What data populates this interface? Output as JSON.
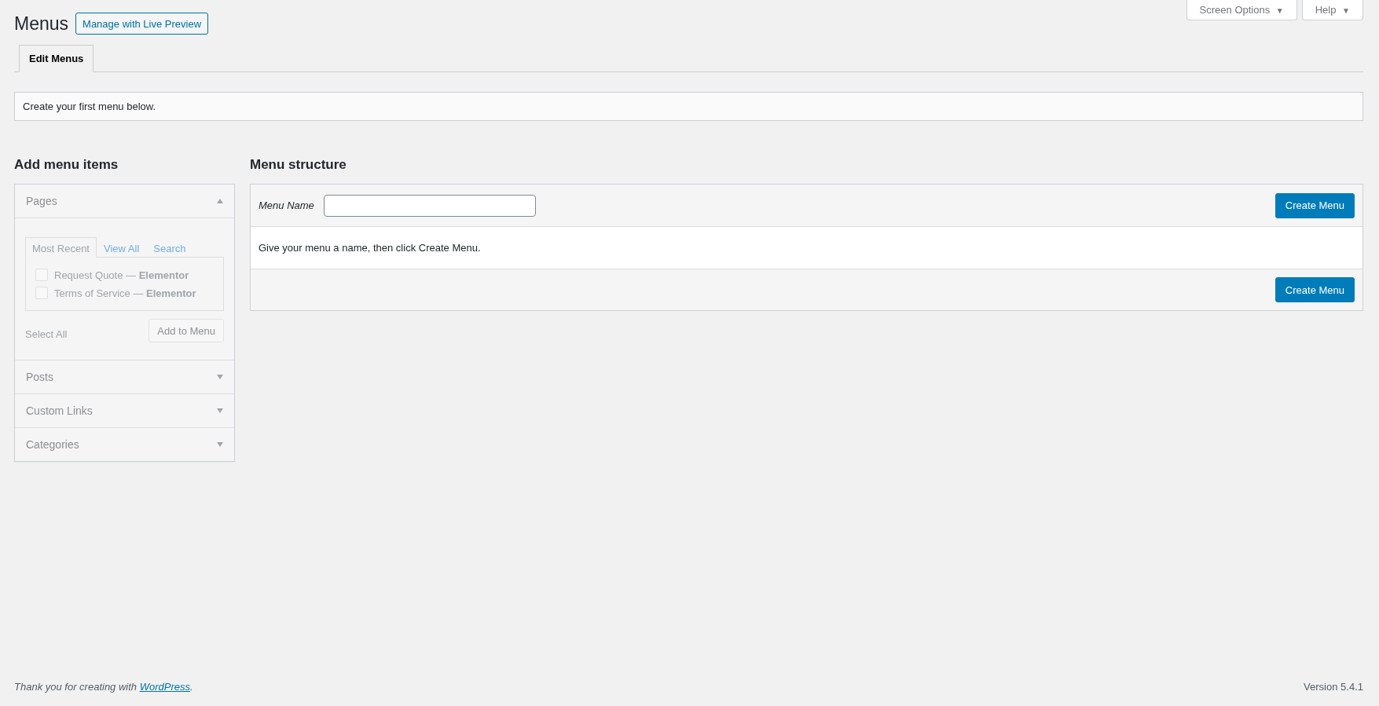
{
  "page_title": "Menus",
  "live_preview_button": "Manage with Live Preview",
  "screen_meta": [
    {
      "label": "Screen Options",
      "arrow": "▼"
    },
    {
      "label": "Help",
      "arrow": "▼"
    }
  ],
  "tabs": [
    {
      "label": "Edit Menus",
      "selected": true
    }
  ],
  "notice": "Create your first menu below.",
  "add_menu_items": {
    "heading": "Add menu items",
    "disabled": true,
    "sections": [
      {
        "title": "Pages",
        "expanded": true,
        "tabs": [
          {
            "label": "Most Recent",
            "selected": true
          },
          {
            "label": "View All",
            "selected": false
          },
          {
            "label": "Search",
            "selected": false
          }
        ],
        "items": [
          {
            "label": "Request Quote — **Elementor**",
            "checked": false
          },
          {
            "label": "Terms of Service — **Elementor**",
            "checked": false
          }
        ],
        "select_all": "Select All",
        "add_button": "Add to Menu"
      },
      {
        "title": "Posts",
        "expanded": false
      },
      {
        "title": "Custom Links",
        "expanded": false
      },
      {
        "title": "Categories",
        "expanded": false
      }
    ]
  },
  "menu_structure": {
    "heading": "Menu structure",
    "name_label": "Menu Name",
    "create_button_top": "Create Menu",
    "instructions": "Give your menu a name, then click Create Menu.",
    "create_button_bottom": "Create Menu"
  },
  "footer": {
    "thanks_before": "Thank you for creating with ",
    "thanks_link": "WordPress",
    "thanks_after": ".",
    "version": "Version 5.4.1"
  }
}
